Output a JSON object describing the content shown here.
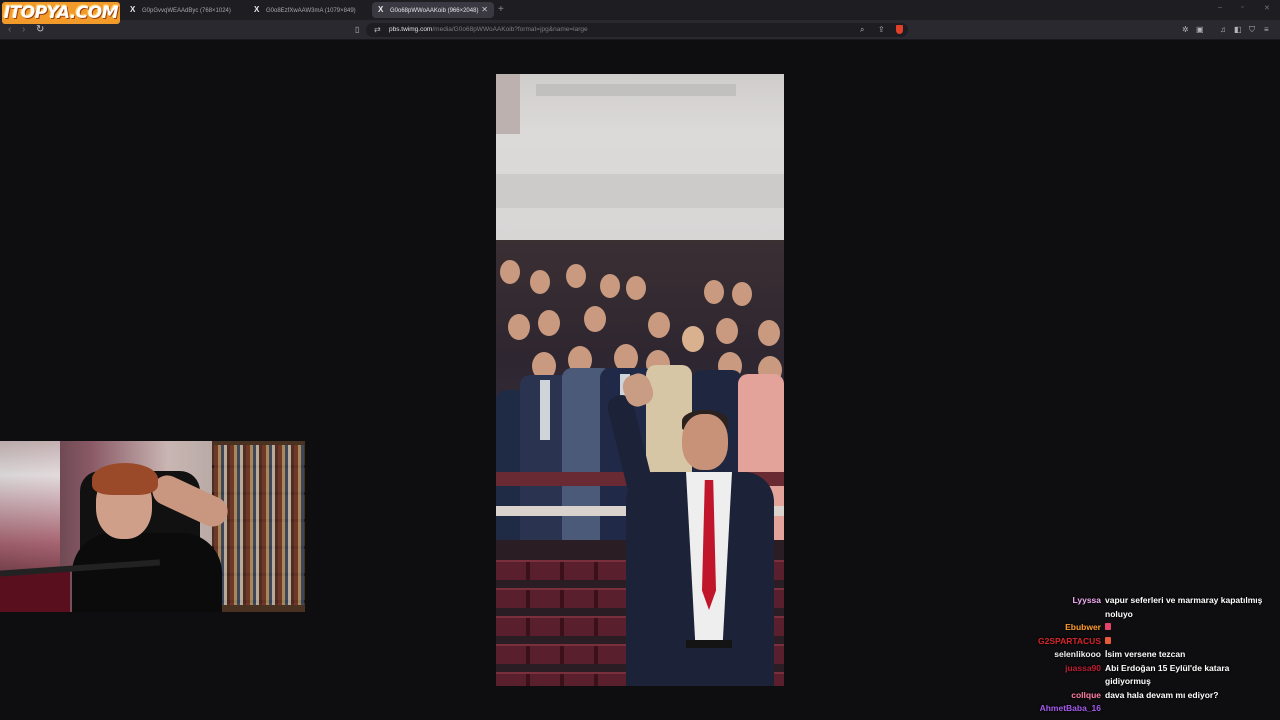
{
  "logo": {
    "text": "ITOPYA.COM"
  },
  "tabs": [
    {
      "label": "G0pGvvqWEAAdByc (768×1024)"
    },
    {
      "label": "G0o8EzfXwAAW3mA (1079×849)"
    },
    {
      "label": "G0o68pWWoAAKoib (966×2048)",
      "active": true
    }
  ],
  "address": {
    "url_host": "pbs.twimg.com",
    "url_path": "/media/G0o68pWWoAAKoib?format=jpg&name=large"
  },
  "icons": {
    "back": "back-arrow-icon",
    "forward": "forward-arrow-icon",
    "reload": "reload-icon",
    "bookmark": "bookmark-icon",
    "site_info": "site-info-icon",
    "zoom": "search-icon",
    "share": "share-icon",
    "brave": "brave-shield-icon",
    "extensions": "extensions-icon",
    "music": "music-icon",
    "sidebar": "sidebar-icon",
    "wallet": "wallet-icon",
    "vpn": "vpn-icon",
    "menu": "menu-icon",
    "tab_close": "close-icon",
    "new_tab": "plus-icon"
  },
  "window_controls": {
    "minimize": "–",
    "maximize": "▫",
    "close": "✕"
  },
  "chat": [
    {
      "user": "Lyyssa",
      "color": "#f3b0f5",
      "text": "vapur seferleri ve marmaray kapatılmış noluyo"
    },
    {
      "user": "Ebubwer",
      "color": "#ff9c2a",
      "text": "",
      "emote": "#e5436c"
    },
    {
      "user": "G2SPARTACUS",
      "color": "#d6262a",
      "text": "",
      "emote": "#e85a3a"
    },
    {
      "user": "selenlikooo",
      "color": "#f0f0f0",
      "text": "İsim versene tezcan"
    },
    {
      "user": "juassa90",
      "color": "#c01c33",
      "text": "Abi Erdoğan 15 Eylül'de katara gidiyormuş"
    },
    {
      "user": "collque",
      "color": "#ff7ea6",
      "text": "dava hala devam mı ediyor?"
    },
    {
      "user": "AhmetBaba_16",
      "color": "#a55af0",
      "text": ""
    }
  ]
}
